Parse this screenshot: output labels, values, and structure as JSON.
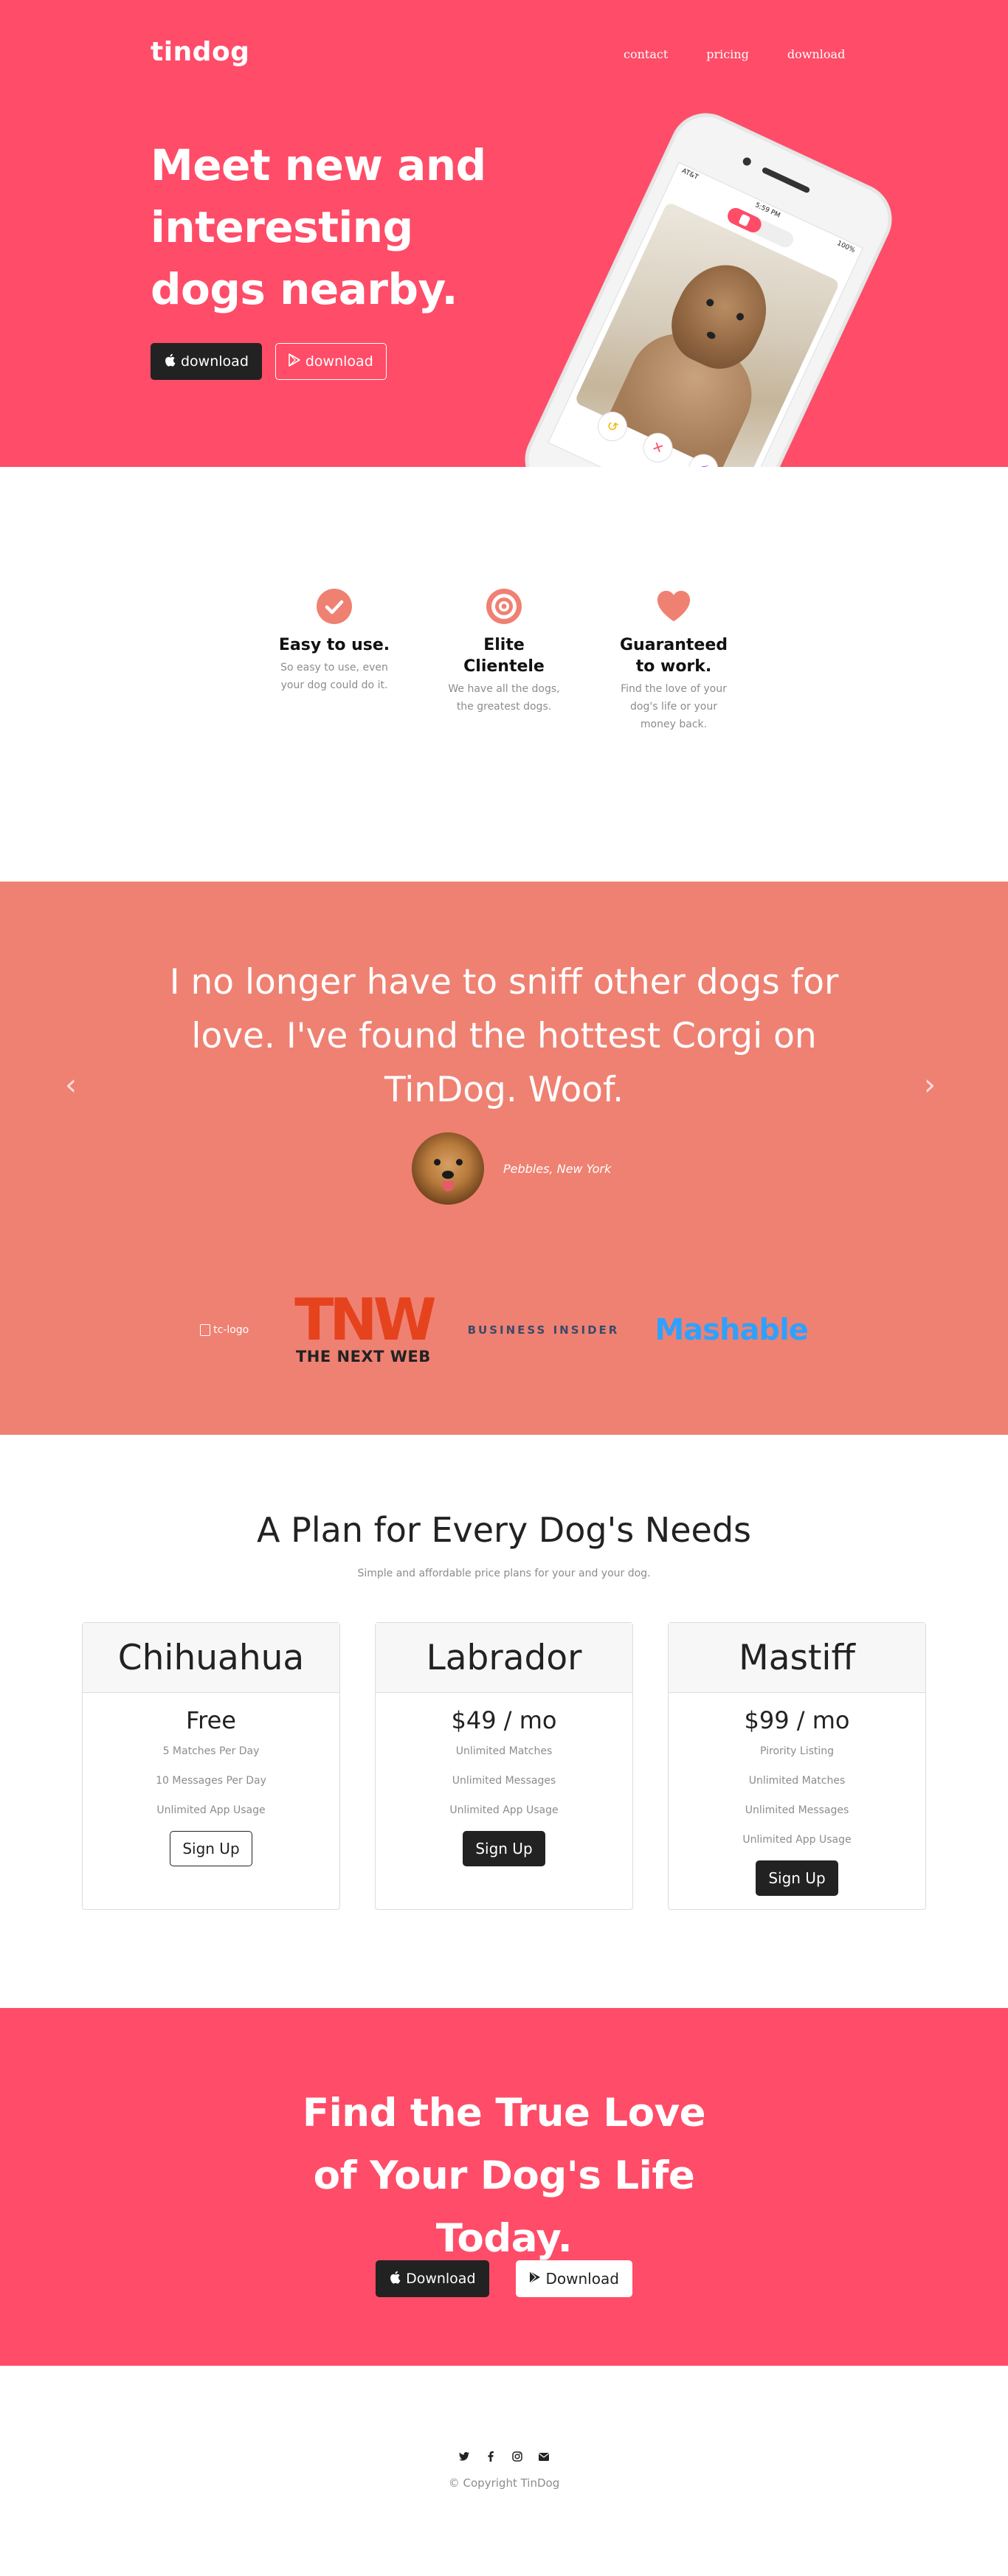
{
  "nav": {
    "brand": "tindog",
    "links": [
      "contact",
      "pricing",
      "download"
    ]
  },
  "hero": {
    "heading": "Meet new and interesting dogs nearby.",
    "buttons": [
      {
        "icon": "apple-icon",
        "label": "download"
      },
      {
        "icon": "play-store-icon",
        "label": "download"
      }
    ],
    "phone": {
      "time": "5:59 PM",
      "carrier": "AT&T",
      "battery": "100%"
    }
  },
  "features": [
    {
      "icon": "check-circle-icon",
      "title": "Easy to use.",
      "text": "So easy to use, even your dog could do it."
    },
    {
      "icon": "bullseye-icon",
      "title": "Elite Clientele",
      "text": "We have all the dogs, the greatest dogs."
    },
    {
      "icon": "heart-icon",
      "title": "Guaranteed to work.",
      "text": "Find the love of your dog's life or your money back."
    }
  ],
  "testimonial": {
    "quote": "I no longer have to sniff other dogs for love. I've found the hottest Corgi on TinDog. Woof.",
    "author": "Pebbles, New York",
    "prev_label": "‹",
    "next_label": "›"
  },
  "press": {
    "tc_alt": "tc-logo",
    "tnw_big": "TNW",
    "tnw_small": "THE NEXT WEB",
    "business_insider": "BUSINESS INSIDER",
    "mashable": "Mashable"
  },
  "pricing": {
    "title": "A Plan for Every Dog's Needs",
    "subtitle": "Simple and affordable price plans for your and your dog.",
    "plans": [
      {
        "name": "Chihuahua",
        "price": "Free",
        "features": [
          "5 Matches Per Day",
          "10 Messages Per Day",
          "Unlimited App Usage"
        ],
        "button": "Sign Up",
        "style": "outline"
      },
      {
        "name": "Labrador",
        "price": "$49 / mo",
        "features": [
          "Unlimited Matches",
          "Unlimited Messages",
          "Unlimited App Usage"
        ],
        "button": "Sign Up",
        "style": "dark"
      },
      {
        "name": "Mastiff",
        "price": "$99 / mo",
        "features": [
          "Pirority Listing",
          "Unlimited Matches",
          "Unlimited Messages",
          "Unlimited App Usage"
        ],
        "button": "Sign Up",
        "style": "dark"
      }
    ]
  },
  "cta": {
    "heading": "Find the True Love of Your Dog's Life Today.",
    "buttons": [
      {
        "icon": "apple-icon",
        "label": "Download"
      },
      {
        "icon": "play-store-icon",
        "label": "Download"
      }
    ]
  },
  "footer": {
    "social_icons": [
      "twitter-icon",
      "facebook-icon",
      "instagram-icon",
      "envelope-icon"
    ],
    "copyright": "© Copyright TinDog"
  },
  "colors": {
    "brand_red": "#ff4c68",
    "testimonial_coral": "#ef8172",
    "dark": "#222222"
  }
}
